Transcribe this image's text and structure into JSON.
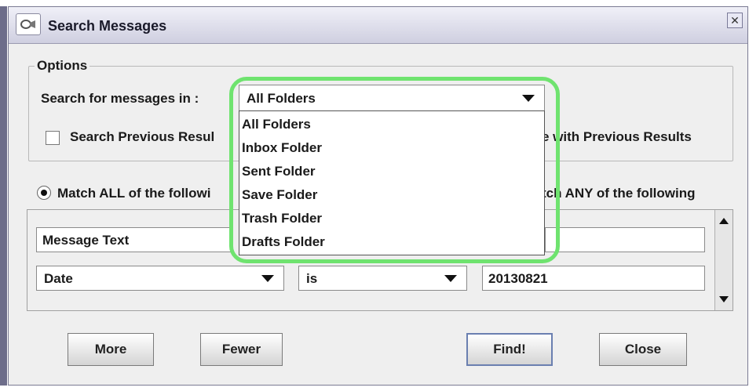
{
  "window": {
    "title": "Search Messages"
  },
  "options": {
    "group_label": "Options",
    "search_label": "Search for messages in :",
    "folder_selected": "All Folders",
    "search_previous_label": "Search Previous Resul",
    "combine_label": "e with Previous Results",
    "folder_options": [
      "All Folders",
      "Inbox Folder",
      "Sent Folder",
      "Save Folder",
      "Trash Folder",
      "Drafts Folder"
    ]
  },
  "match": {
    "all_label": "Match ALL of the follo",
    "all_label_suffix": "wi",
    "any_label": "tch ANY of the following"
  },
  "criteria": {
    "row1_field": "Message Text",
    "row2_field": "Date",
    "row2_operator": "is",
    "row2_value": "20130821"
  },
  "buttons": {
    "more": "More",
    "fewer": "Fewer",
    "find": "Find!",
    "close": "Close"
  },
  "colors": {
    "highlight": "#6fe36f",
    "titlebar": "#dcdcec",
    "window_bg": "#efefef"
  }
}
